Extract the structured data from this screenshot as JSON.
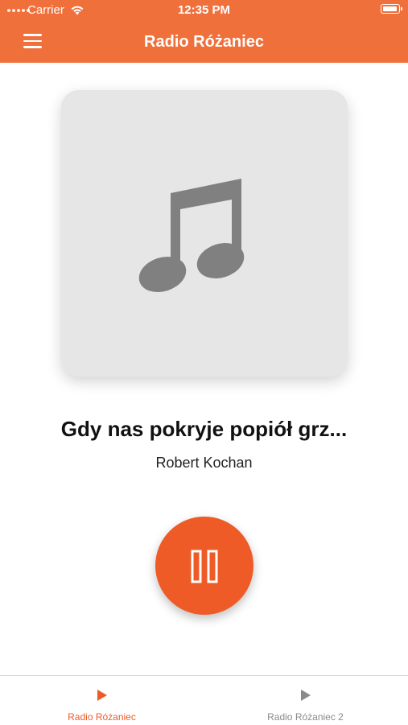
{
  "status_bar": {
    "carrier": "Carrier",
    "time": "12:35 PM"
  },
  "header": {
    "title": "Radio Różaniec",
    "menu_icon": "hamburger-menu-icon",
    "background_color": "#f0703c"
  },
  "player": {
    "artwork_icon": "music-note-icon",
    "song_title": "Gdy nas pokryje popiół grz...",
    "artist": "Robert Kochan",
    "control_icon": "pause-icon",
    "control_color": "#ee5b27"
  },
  "tabs": [
    {
      "label": "Radio Różaniec",
      "icon": "play-icon",
      "active": true,
      "color": "#ee5b27"
    },
    {
      "label": "Radio Różaniec 2",
      "icon": "play-icon",
      "active": false,
      "color": "#8a8a8a"
    }
  ]
}
